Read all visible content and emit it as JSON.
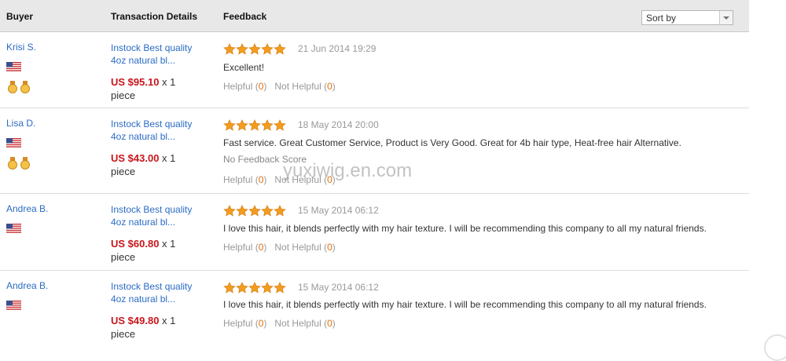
{
  "header": {
    "buyer": "Buyer",
    "transaction": "Transaction Details",
    "feedback": "Feedback",
    "sort_value": "Sort by"
  },
  "rows": [
    {
      "buyer": "Krisi S.",
      "product_line1": "Instock Best quality",
      "product_line2": "4oz natural bl...",
      "price": "US $95.10",
      "qty": " x 1",
      "unit": "piece",
      "rating": 5,
      "date": "21 Jun 2014 19:29",
      "comment": "Excellent!",
      "helpful_label": "Helpful",
      "helpful_count": "0",
      "not_helpful_label": "Not Helpful",
      "not_helpful_count": "0",
      "has_medals": true
    },
    {
      "buyer": "Lisa D.",
      "product_line1": "Instock Best quality",
      "product_line2": "4oz natural bl...",
      "price": "US $43.00",
      "qty": " x 1",
      "unit": "piece",
      "rating": 5,
      "date": "18 May 2014 20:00",
      "comment": "Fast service. Great Customer Service, Product is Very Good. Great for 4b hair type, Heat-free hair Alternative.",
      "no_feedback": "No Feedback Score",
      "helpful_label": "Helpful",
      "helpful_count": "0",
      "not_helpful_label": "Not Helpful",
      "not_helpful_count": "0",
      "has_medals": true
    },
    {
      "buyer": "Andrea B.",
      "product_line1": "Instock Best quality",
      "product_line2": "4oz natural bl...",
      "price": "US $60.80",
      "qty": " x 1",
      "unit": "piece",
      "rating": 5,
      "date": "15 May 2014 06:12",
      "comment": "I love this hair, it blends perfectly with my hair texture. I will be recommending this company to all my natural friends.",
      "helpful_label": "Helpful",
      "helpful_count": "0",
      "not_helpful_label": "Not Helpful",
      "not_helpful_count": "0",
      "has_medals": false
    },
    {
      "buyer": "Andrea B.",
      "product_line1": "Instock Best quality",
      "product_line2": "4oz natural bl...",
      "price": "US $49.80",
      "qty": " x 1",
      "unit": "piece",
      "rating": 5,
      "date": "15 May 2014 06:12",
      "comment": "I love this hair, it blends perfectly with my hair texture. I will be recommending this company to all my natural friends.",
      "helpful_label": "Helpful",
      "helpful_count": "0",
      "not_helpful_label": "Not Helpful",
      "not_helpful_count": "0",
      "has_medals": false
    }
  ],
  "watermark": "yuxiwig.en.com",
  "colors": {
    "link": "#2b6cc4",
    "price": "#c8161d",
    "star": "#f39c1f",
    "count": "#e2700b"
  },
  "icons": {
    "flag": "us-flag-icon",
    "medal": "medal-icon",
    "star": "star-icon",
    "sort_arrow": "chevron-down-icon"
  }
}
